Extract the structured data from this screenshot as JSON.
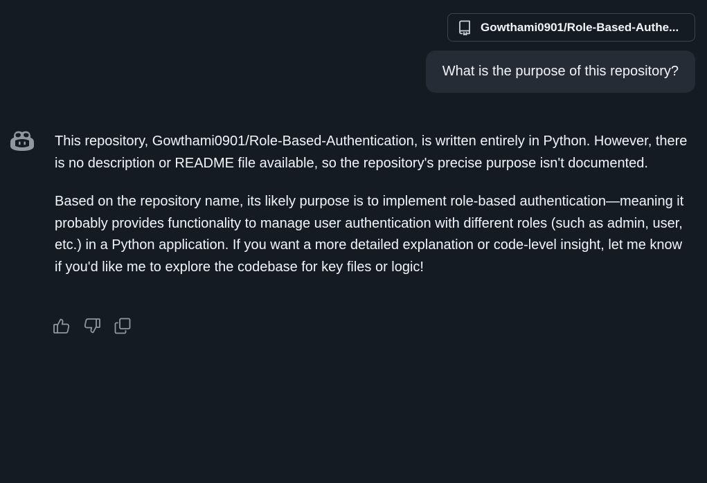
{
  "repo_chip": {
    "label": "Gowthami0901/Role-Based-Authe...",
    "icon": "repo-icon"
  },
  "user_message": {
    "text": "What is the purpose of this repository?"
  },
  "assistant_message": {
    "avatar_icon": "copilot-icon",
    "paragraphs": [
      "This repository, Gowthami0901/Role-Based-Authentication, is written entirely in Python. However, there is no description or README file available, so the repository's precise purpose isn't documented.",
      "Based on the repository name, its likely purpose is to implement role-based authentication—meaning it probably provides functionality to manage user authentication with different roles (such as admin, user, etc.) in a Python application. If you want a more detailed explanation or code-level insight, let me know if you'd like me to explore the codebase for key files or logic!"
    ]
  },
  "actions": {
    "icons": [
      "thumbs-up-icon",
      "thumbs-down-icon",
      "copy-icon"
    ]
  },
  "colors": {
    "background": "#151b23",
    "bubble": "#262c36",
    "border": "#3d444d",
    "text": "#f0f6fc",
    "icon": "#9198a1"
  }
}
